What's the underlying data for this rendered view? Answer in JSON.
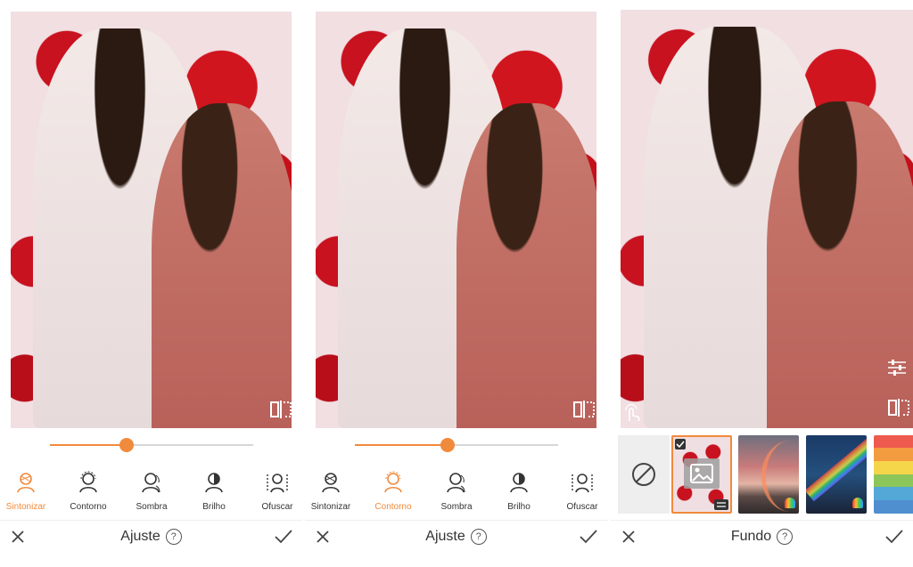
{
  "panels": [
    {
      "tools": [
        "Sintonizar",
        "Contorno",
        "Sombra",
        "Brilho",
        "Ofuscar"
      ],
      "active_tool": "Sintonizar",
      "slider_value": 0.44,
      "footer_title": "Ajuste"
    },
    {
      "tools": [
        "Sintonizar",
        "Contorno",
        "Sombra",
        "Brilho",
        "Ofuscar"
      ],
      "active_tool": "Contorno",
      "slider_value": 0.46,
      "footer_title": "Ajuste"
    },
    {
      "footer_title": "Fundo",
      "backgrounds": [
        "none",
        "custom-image",
        "rainbow-sky",
        "rainbow-night",
        "rainbow-stripes"
      ]
    }
  ],
  "help_glyph": "?",
  "colors": {
    "accent": "#f08a3c",
    "text": "#333333",
    "inactive_track": "#d7d7d7"
  }
}
